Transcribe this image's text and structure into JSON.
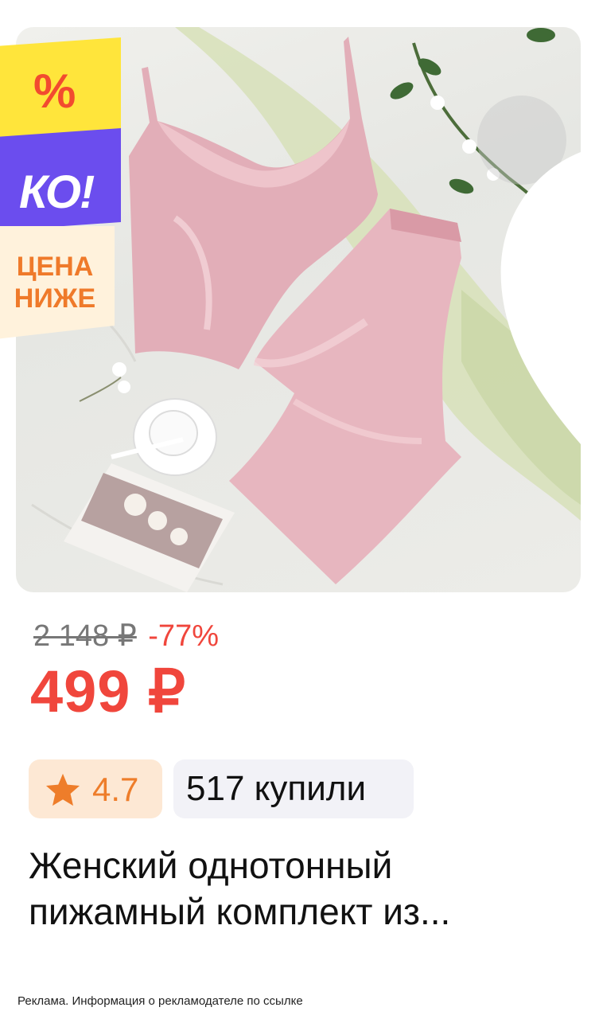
{
  "product": {
    "photo": {
      "alt": "pink-satin-pajama-set-photo"
    },
    "promo_badge": {
      "percent": "%",
      "ko": "КО!",
      "line1": "ЦЕНА",
      "line2": "НИЖЕ"
    },
    "favorite_icon": "heart-icon",
    "old_price": "2 148 ₽",
    "discount": "-77%",
    "current_price": "499 ₽",
    "rating": {
      "icon": "star-icon",
      "value": "4.7"
    },
    "bought": "517 купили",
    "title": "Женский однотонный пижамный комплект из..."
  },
  "ad_disclaimer": "Реклама. Информация о рекламодателе по ссылке",
  "colors": {
    "price_red": "#f0463c",
    "rating_orange": "#ee7d2a",
    "rating_bg": "#fde8d4",
    "chip_bg": "#f2f2f7",
    "promo_yellow": "#ffe53b",
    "promo_purple": "#6b4dee"
  }
}
